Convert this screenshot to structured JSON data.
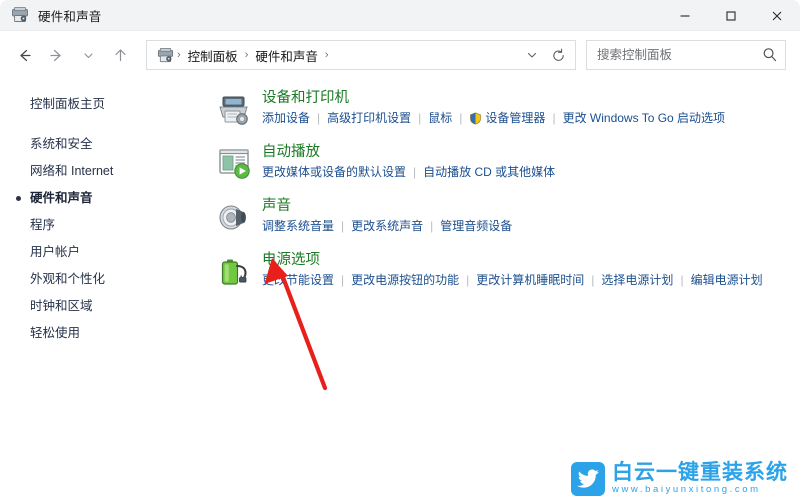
{
  "window": {
    "title": "硬件和声音",
    "title_icon": "control-panel-icon",
    "controls": {
      "minimize": "最小化",
      "maximize": "最大化",
      "close": "关闭"
    }
  },
  "toolbar": {
    "back": "后退",
    "forward": "前进",
    "recent": "最近使用的位置",
    "up": "向上",
    "breadcrumb": {
      "icon": "control-panel-icon",
      "items": [
        "控制面板",
        "硬件和声音"
      ],
      "separator": "›",
      "trailing_separator": "›"
    },
    "address_chevron": "⌄",
    "refresh": "刷新"
  },
  "search": {
    "placeholder": "搜索控制面板",
    "value": "",
    "icon": "search-icon"
  },
  "sidebar": {
    "home": "控制面板主页",
    "items": [
      {
        "label": "系统和安全",
        "current": false
      },
      {
        "label": "网络和 Internet",
        "current": false
      },
      {
        "label": "硬件和声音",
        "current": true
      },
      {
        "label": "程序",
        "current": false
      },
      {
        "label": "用户帐户",
        "current": false
      },
      {
        "label": "外观和个性化",
        "current": false
      },
      {
        "label": "时钟和区域",
        "current": false
      },
      {
        "label": "轻松使用",
        "current": false
      }
    ]
  },
  "categories": [
    {
      "title": "设备和打印机",
      "icon": "printer-icon",
      "links": [
        {
          "label": "添加设备",
          "shield": false
        },
        {
          "label": "高级打印机设置",
          "shield": false
        },
        {
          "label": "鼠标",
          "shield": false
        },
        {
          "label": "设备管理器",
          "shield": true
        },
        {
          "label": "更改 Windows To Go 启动选项",
          "shield": false
        }
      ]
    },
    {
      "title": "自动播放",
      "icon": "autoplay-icon",
      "links": [
        {
          "label": "更改媒体或设备的默认设置",
          "shield": false
        },
        {
          "label": "自动播放 CD 或其他媒体",
          "shield": false
        }
      ]
    },
    {
      "title": "声音",
      "icon": "speaker-icon",
      "links": [
        {
          "label": "调整系统音量",
          "shield": false
        },
        {
          "label": "更改系统声音",
          "shield": false
        },
        {
          "label": "管理音频设备",
          "shield": false
        }
      ]
    },
    {
      "title": "电源选项",
      "icon": "battery-plug-icon",
      "links": [
        {
          "label": "更改节能设置",
          "shield": false
        },
        {
          "label": "更改电源按钮的功能",
          "shield": false
        },
        {
          "label": "更改计算机睡眠时间",
          "shield": false
        },
        {
          "label": "选择电源计划",
          "shield": false
        },
        {
          "label": "编辑电源计划",
          "shield": false
        }
      ]
    }
  ],
  "annotation": {
    "type": "red-arrow",
    "color": "#e8201c",
    "points_to": "电源选项"
  },
  "watermark": {
    "brand": "白云一键重装系统",
    "url": "www.baiyunxitong.com",
    "color": "#2ca3e8",
    "logo": "bird-icon"
  },
  "colors": {
    "heading_green": "#1a7b23",
    "link_blue": "#1c4f8f",
    "sidebar_text": "#26324a",
    "titlebar_bg": "#f2f3f5"
  }
}
